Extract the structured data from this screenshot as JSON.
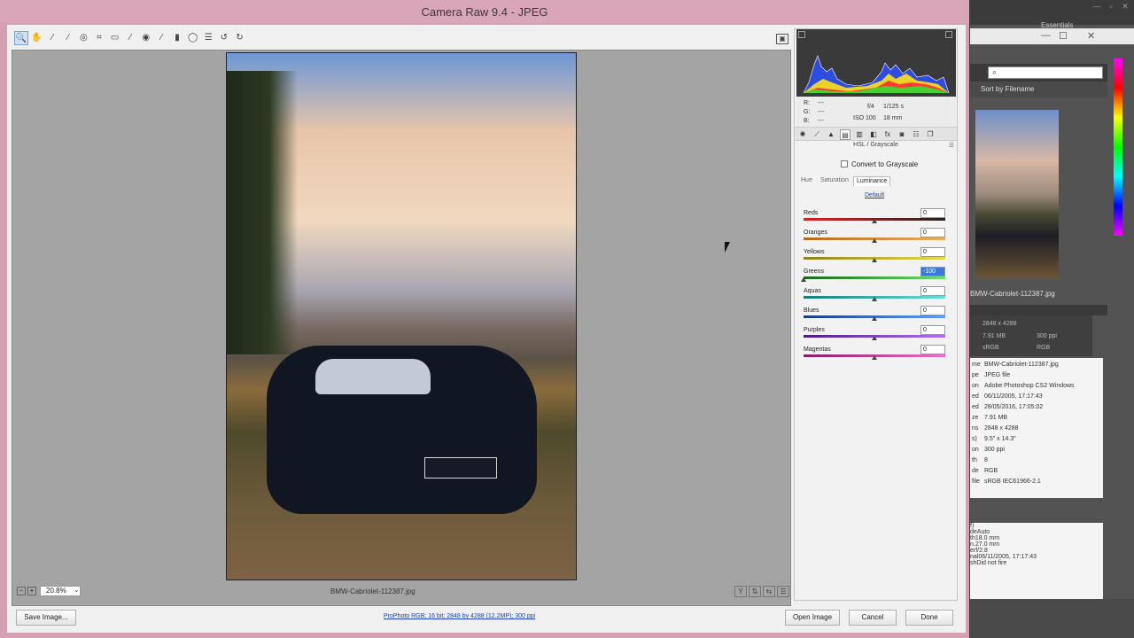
{
  "bridge": {
    "essentials": "Essentials",
    "search_placeholder": "",
    "sort_label": "Sort by Filename",
    "thumb_label": "BMW-Cabriolet-112387.jpg",
    "preview_info": {
      "dimensions": "2848 x 4288",
      "size": "7.91 MB",
      "ppi": "300 ppi",
      "colorspace": "sRGB",
      "mode": "RGB"
    },
    "metadata": [
      {
        "k": "me",
        "v": "BMW-Cabriolet-112387.jpg"
      },
      {
        "k": "pe",
        "v": "JPEG file"
      },
      {
        "k": "on",
        "v": "Adobe Photoshop CS2 Windows"
      },
      {
        "k": "ed",
        "v": "06/11/2005, 17:17:43"
      },
      {
        "k": "ed",
        "v": "28/05/2016, 17:05:02"
      },
      {
        "k": "ze",
        "v": "7.91 MB"
      },
      {
        "k": "ns",
        "v": "2848 x 4288"
      },
      {
        "k": "s)",
        "v": "9.5\" x 14.3\""
      },
      {
        "k": "on",
        "v": "300 ppi"
      },
      {
        "k": "th",
        "v": "8"
      },
      {
        "k": "de",
        "v": "RGB"
      },
      {
        "k": "file",
        "v": "sRGB IEC61966-2.1"
      }
    ],
    "metadata2": [
      {
        "k": "f)",
        "v": ""
      },
      {
        "k": "de",
        "v": "Auto"
      },
      {
        "k": "th",
        "v": "18.0 mm"
      },
      {
        "k": "n.",
        "v": "27.0 mm"
      },
      {
        "k": "er",
        "v": "f/2.8"
      },
      {
        "k": "nal",
        "v": "06/11/2005, 17:17:43"
      },
      {
        "k": "sh",
        "v": "Did not fire"
      }
    ]
  },
  "dialog": {
    "title": "Camera Raw 9.4  -  JPEG",
    "toolbar": {
      "tools": [
        {
          "name": "zoom-tool",
          "glyph": "🔍"
        },
        {
          "name": "hand-tool",
          "glyph": "✋"
        },
        {
          "name": "white-balance-tool",
          "glyph": "⁄"
        },
        {
          "name": "color-sampler-tool",
          "glyph": "⁄"
        },
        {
          "name": "targeted-adjustment-tool",
          "glyph": "◎"
        },
        {
          "name": "crop-tool",
          "glyph": "⌗"
        },
        {
          "name": "straighten-tool",
          "glyph": "▭"
        },
        {
          "name": "spot-removal-tool",
          "glyph": "⁄"
        },
        {
          "name": "red-eye-tool",
          "glyph": "◉"
        },
        {
          "name": "adjustment-brush-tool",
          "glyph": "⁄"
        },
        {
          "name": "graduated-filter-tool",
          "glyph": "▮"
        },
        {
          "name": "radial-filter-tool",
          "glyph": "◯"
        },
        {
          "name": "preferences-tool",
          "glyph": "☰"
        },
        {
          "name": "rotate-left-tool",
          "glyph": "↺"
        },
        {
          "name": "rotate-right-tool",
          "glyph": "↻"
        }
      ]
    },
    "zoom": "20.8%",
    "filename": "BMW-Cabriolet-112387.jpg",
    "save_label": "Save Image...",
    "workflow_label": "ProPhoto RGB; 16 bit; 2848 by 4288 (12.2MP); 300 ppi",
    "open_label": "Open Image",
    "cancel_label": "Cancel",
    "done_label": "Done"
  },
  "panel": {
    "readout": {
      "r": "R:",
      "g": "G:",
      "b": "B:",
      "dash": "---",
      "aperture": "f/4",
      "shutter": "1/125 s",
      "iso": "ISO 100",
      "focal": "18 mm"
    },
    "section_title": "HSL / Grayscale",
    "grayscale_label": "Convert to Grayscale",
    "subtabs": [
      "Hue",
      "Saturation",
      "Luminance"
    ],
    "active_subtab": "Luminance",
    "default_link": "Default",
    "sliders": [
      {
        "label": "Reds",
        "value": "0",
        "level": 0,
        "from": "#d22",
        "to": "#222"
      },
      {
        "label": "Oranges",
        "value": "0",
        "level": 0,
        "from": "#b36a1a",
        "to": "#e8b060"
      },
      {
        "label": "Yellows",
        "value": "0",
        "level": 0,
        "from": "#8a8420",
        "to": "#eadb4a"
      },
      {
        "label": "Greens",
        "value": "-100",
        "level": -100,
        "from": "#1a6a1a",
        "to": "#6be06b"
      },
      {
        "label": "Aquas",
        "value": "0",
        "level": 0,
        "from": "#157c7c",
        "to": "#68e0e0"
      },
      {
        "label": "Blues",
        "value": "0",
        "level": 0,
        "from": "#1a3a8a",
        "to": "#5fa0f0"
      },
      {
        "label": "Purples",
        "value": "0",
        "level": 0,
        "from": "#4e1a8a",
        "to": "#b070f0"
      },
      {
        "label": "Magentas",
        "value": "0",
        "level": 0,
        "from": "#8a1a6a",
        "to": "#f070c8"
      }
    ]
  }
}
